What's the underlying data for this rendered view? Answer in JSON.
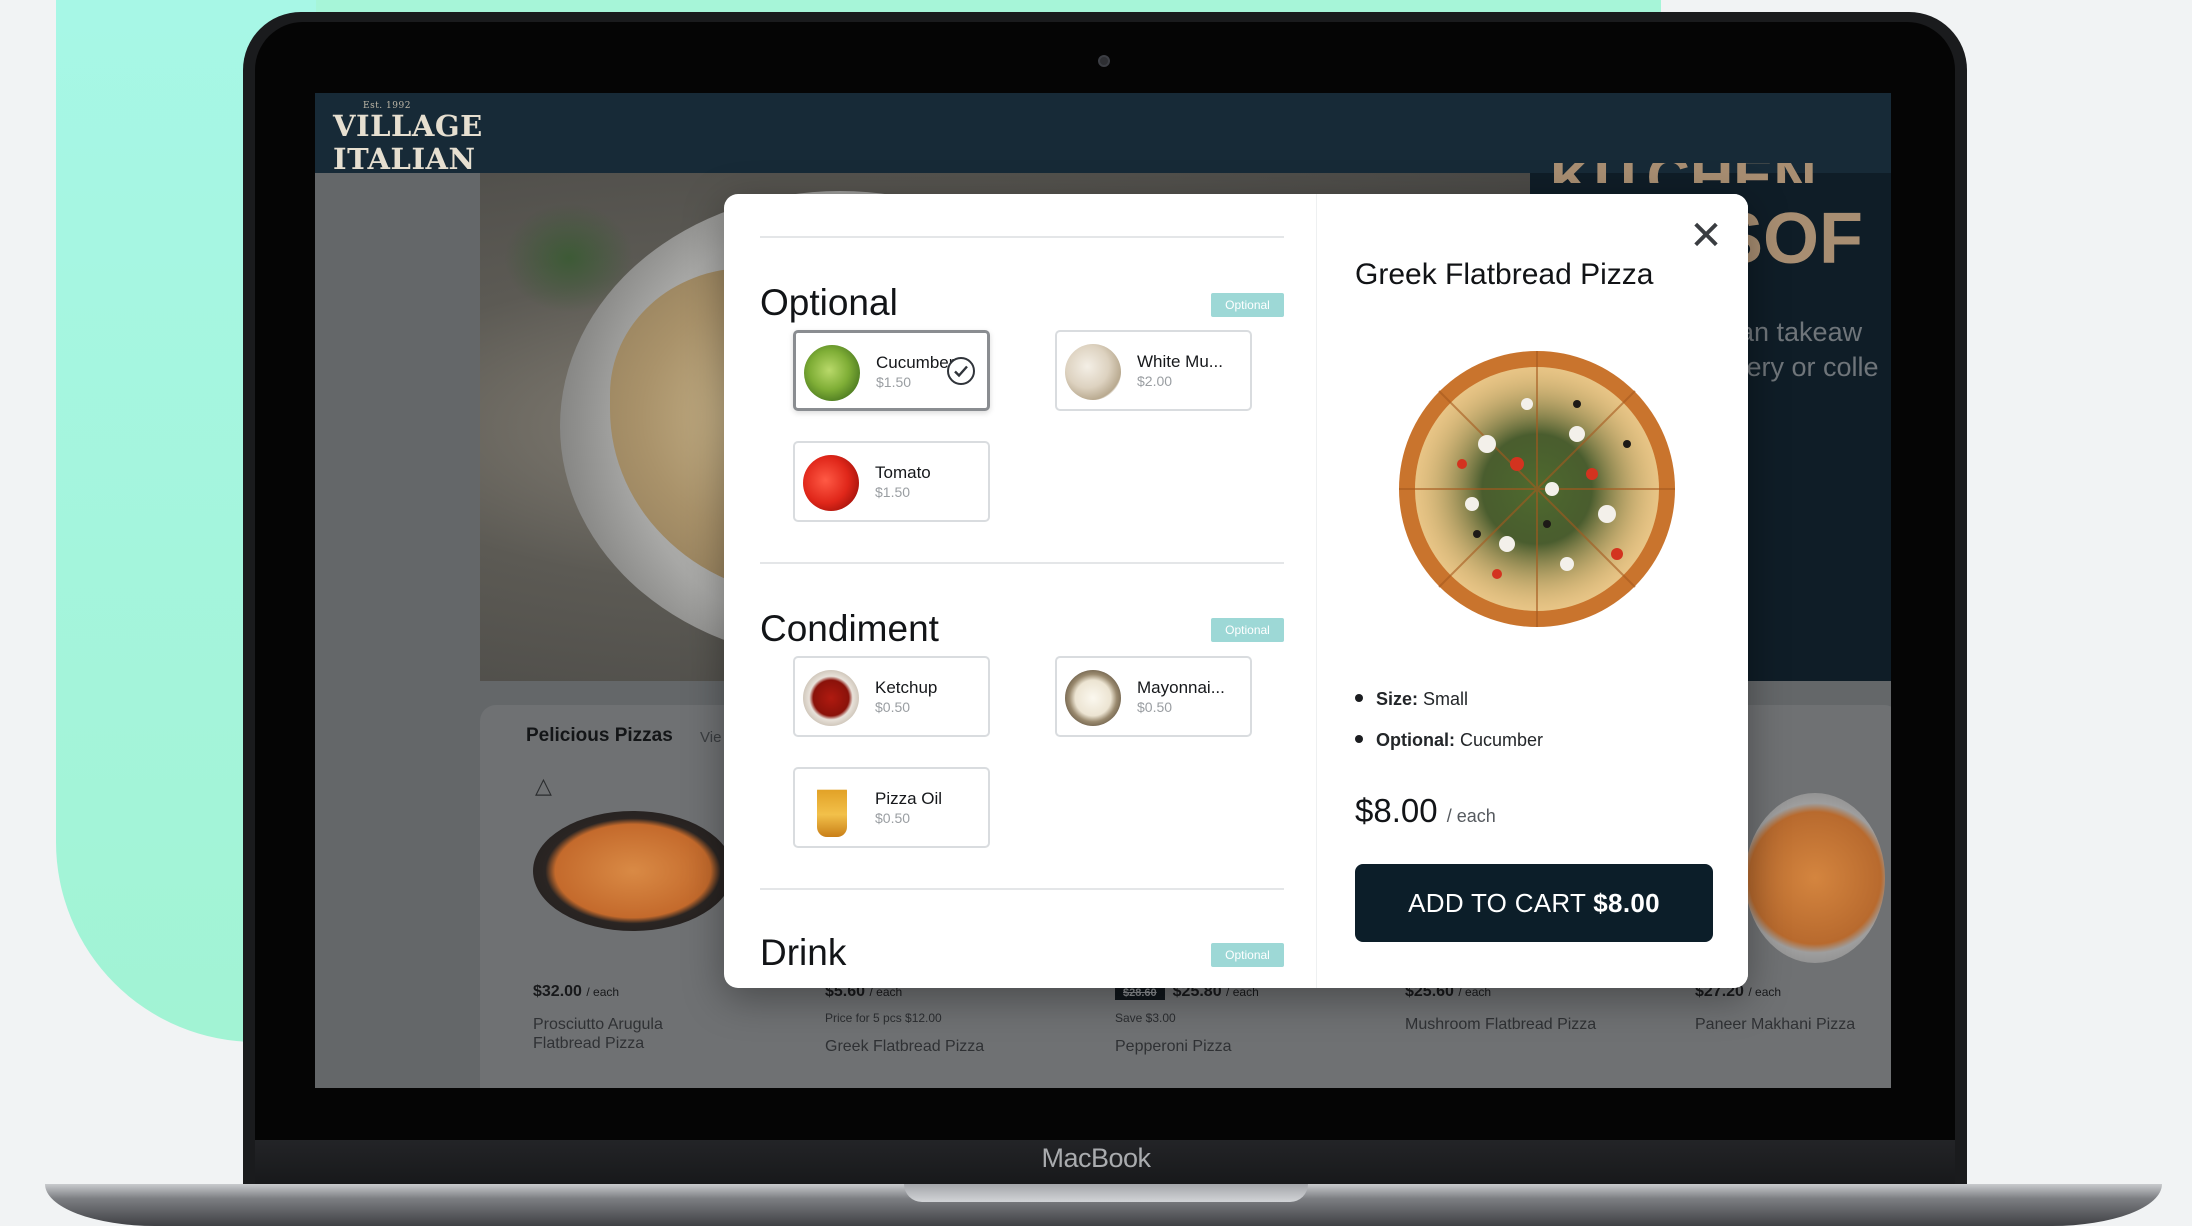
{
  "device": {
    "brand": "MacBook"
  },
  "site": {
    "logo_sup": "Est. 1992",
    "logo_line1": "VILLAGE",
    "logo_line2": "ITALIAN",
    "hero_title_top": "KITCHEN",
    "hero_title": "SOF",
    "hero_text_1": "ian takeaw",
    "hero_text_2": "very or colle"
  },
  "menu_section": {
    "title": "Pelicious Pizzas",
    "view_link": "Vie",
    "cards": [
      {
        "price": "$32.00",
        "unit": "/ each",
        "sub": "",
        "name": "Prosciutto Arugula Flatbread Pizza"
      },
      {
        "price": "$5.60",
        "unit": "/ each",
        "sub": "Price for 5 pcs $12.00",
        "name": "Greek Flatbread Pizza"
      },
      {
        "old_price": "$28.60",
        "price": "$25.80",
        "unit": "/ each",
        "sub": "Save $3.00",
        "name": "Pepperoni Pizza"
      },
      {
        "price": "$25.60",
        "unit": "/ each",
        "sub": "",
        "name": "Mushroom Flatbread Pizza"
      },
      {
        "price": "$27.20",
        "unit": "/ each",
        "sub": "",
        "name": "Paneer Makhani Pizza"
      }
    ]
  },
  "modal": {
    "groups": [
      {
        "title": "Optional",
        "badge": "Optional",
        "items": [
          {
            "name": "Cucumber",
            "price": "$1.50",
            "selected": true,
            "icon": "cucumber-icon"
          },
          {
            "name": "White Mu...",
            "price": "$2.00",
            "selected": false,
            "icon": "mushroom-icon"
          },
          {
            "name": "Tomato",
            "price": "$1.50",
            "selected": false,
            "icon": "tomato-icon"
          }
        ]
      },
      {
        "title": "Condiment",
        "badge": "Optional",
        "items": [
          {
            "name": "Ketchup",
            "price": "$0.50",
            "selected": false,
            "icon": "ketchup-icon"
          },
          {
            "name": "Mayonnai...",
            "price": "$0.50",
            "selected": false,
            "icon": "mayonnaise-icon"
          },
          {
            "name": "Pizza Oil",
            "price": "$0.50",
            "selected": false,
            "icon": "oil-bottle-icon"
          }
        ]
      },
      {
        "title": "Drink",
        "badge": "Optional",
        "items": []
      }
    ],
    "summary": {
      "close_icon": "close-icon",
      "product_name": "Greek Flatbread Pizza",
      "specs": [
        {
          "label": "Size:",
          "value": "Small"
        },
        {
          "label": "Optional:",
          "value": "Cucumber"
        }
      ],
      "price": "$8.00",
      "price_unit": "/ each",
      "add_to_cart_label": "ADD TO CART",
      "add_to_cart_amount": "$8.00"
    }
  },
  "colors": {
    "accent_dark": "#0c1e29",
    "badge": "#9dd8d6",
    "mint": "#a6f5d8"
  }
}
